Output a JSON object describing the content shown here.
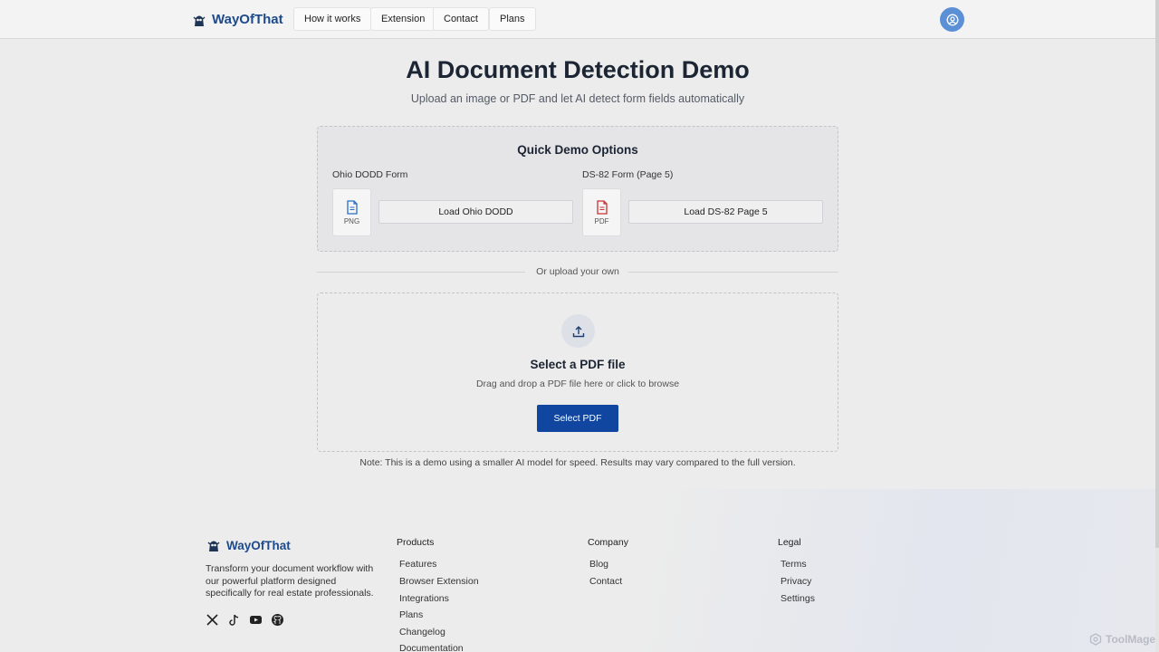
{
  "header": {
    "brand": "WayOfThat",
    "nav": [
      "How it works",
      "Extension",
      "Contact",
      "Plans"
    ]
  },
  "hero": {
    "title": "AI Document Detection Demo",
    "subtitle": "Upload an image or PDF and let AI detect form fields automatically"
  },
  "quick_demo": {
    "title": "Quick Demo Options",
    "options": [
      {
        "label": "Ohio DODD Form",
        "file_type": "PNG",
        "button": "Load Ohio DODD",
        "icon": "document-icon"
      },
      {
        "label": "DS-82 Form (Page 5)",
        "file_type": "PDF",
        "button": "Load DS-82 Page 5",
        "icon": "pdf-document-icon"
      }
    ]
  },
  "divider_text": "Or upload your own",
  "upload": {
    "title": "Select a PDF file",
    "hint": "Drag and drop a PDF file here or click to browse",
    "button": "Select PDF",
    "icon": "upload-icon"
  },
  "note": "Note: This is a demo using a smaller AI model for speed. Results may vary compared to the full version.",
  "footer": {
    "brand": "WayOfThat",
    "description": "Transform your document workflow with our powerful platform designed specifically for real estate professionals.",
    "social": [
      "x-icon",
      "tiktok-icon",
      "youtube-icon",
      "github-icon"
    ],
    "columns": [
      {
        "heading": "Products",
        "links": [
          "Features",
          "Browser Extension",
          "Integrations",
          "Plans",
          "Changelog",
          "Documentation"
        ]
      },
      {
        "heading": "Company",
        "links": [
          "Blog",
          "Contact"
        ]
      },
      {
        "heading": "Legal",
        "links": [
          "Terms",
          "Privacy",
          "Settings"
        ]
      }
    ]
  },
  "watermark": "ToolMage",
  "colors": {
    "brand": "#1d4a8a",
    "primary_button": "#1146a0",
    "avatar": "#5b8fd6"
  }
}
